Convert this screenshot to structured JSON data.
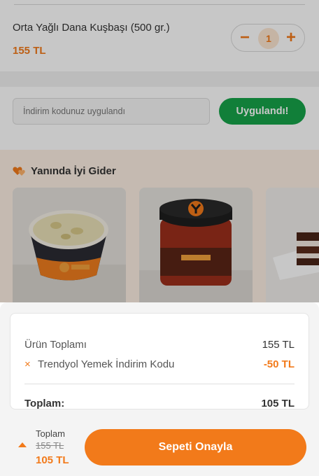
{
  "cart_item": {
    "name": "Orta Yağlı Dana Kuşbaşı (500 gr.)",
    "price": "155 TL",
    "quantity": "1",
    "decrease_symbol": "−",
    "increase_symbol": "+"
  },
  "coupon": {
    "input_placeholder": "İndirim kodunuz uygulandı",
    "button_label": "Uygulandı!"
  },
  "suggestions": {
    "title": "Yanında İyi Gider",
    "icon": "hearts-icon",
    "products": [
      {
        "icon": "soup-bowl-image"
      },
      {
        "icon": "sauce-jar-image"
      },
      {
        "icon": "cake-image"
      }
    ]
  },
  "summary": {
    "subtotal_label": "Ürün Toplamı",
    "subtotal_value": "155 TL",
    "discount_label": "Trendyol Yemek İndirim Kodu",
    "discount_value": "-50 TL",
    "discount_icon": "×",
    "total_label": "Toplam:",
    "total_value": "105 TL"
  },
  "footer": {
    "label": "Toplam",
    "old_price": "155 TL",
    "new_price": "105 TL",
    "confirm_label": "Sepeti Onayla"
  },
  "colors": {
    "accent": "#f27a1a",
    "success": "#16a34a"
  }
}
